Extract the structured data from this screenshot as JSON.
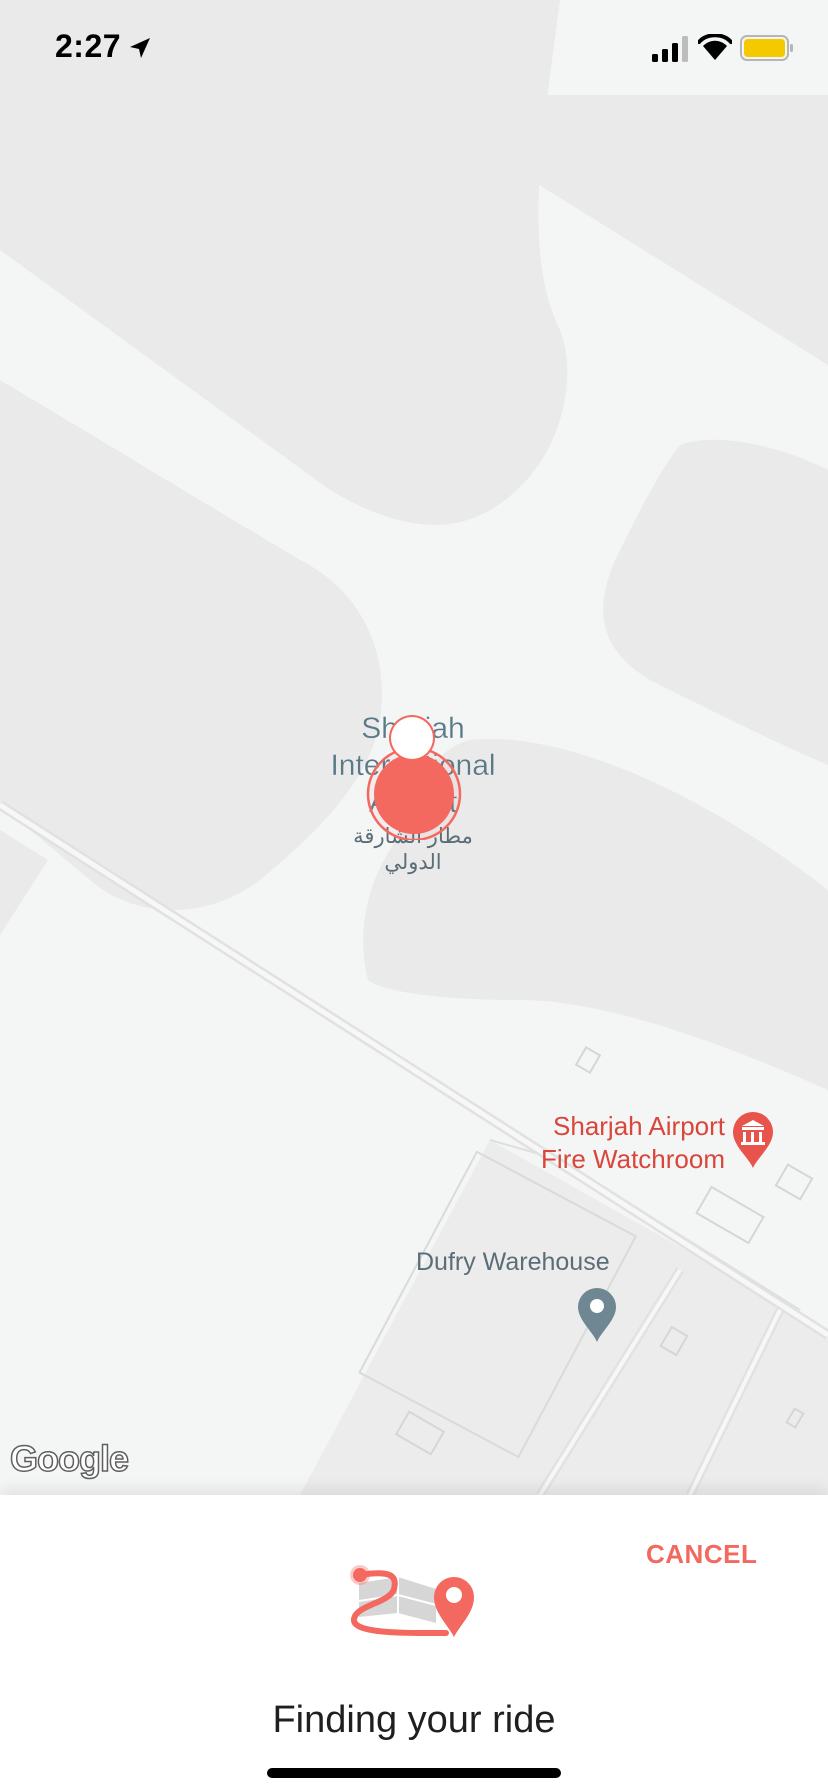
{
  "status_bar": {
    "time": "2:27"
  },
  "map": {
    "airport_label_lines": [
      "Sharjah",
      "International",
      "Airport"
    ],
    "airport_label_arabic_lines": [
      "مطار الشارقة",
      "الدولي"
    ],
    "poi_fire_lines": [
      "Sharjah Airport",
      "Fire Watchroom"
    ],
    "poi_dufry": "Dufry Warehouse",
    "attribution": "Google"
  },
  "sheet": {
    "cancel_label": "CANCEL",
    "finding_text": "Finding your ride"
  },
  "colors": {
    "accent": "#f3685f",
    "poi_red": "#d9463a",
    "label_blue": "#5b7a87"
  },
  "icons": {
    "location": "location-arrow-icon",
    "signal": "cellular-signal-icon",
    "wifi": "wifi-icon",
    "battery": "battery-icon",
    "pickup": "pickup-pin-icon",
    "fire": "fire-station-icon",
    "dufry": "map-pin-icon",
    "finding": "route-map-icon"
  }
}
